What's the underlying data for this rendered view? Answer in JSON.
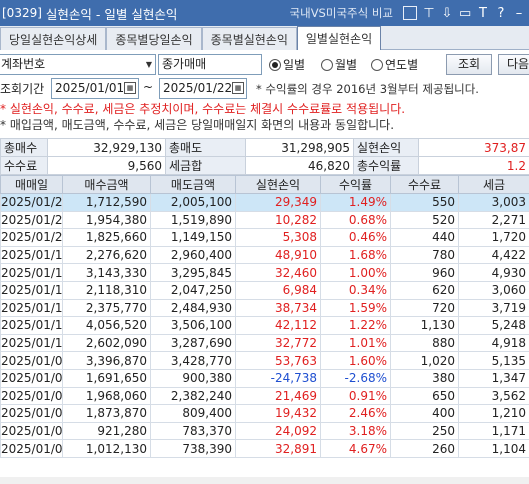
{
  "window": {
    "code": "[0329]",
    "title": "실현손익 - 일별 실현손익",
    "link": "국내VS미국주식 비교",
    "icons": [
      "copy-icon",
      "pin-icon",
      "download-icon",
      "print-icon",
      "text-size-icon",
      "help-icon",
      "minimize-icon"
    ]
  },
  "tabs": [
    {
      "label": "당일실현손익상세",
      "active": false
    },
    {
      "label": "종목별당일손익",
      "active": false
    },
    {
      "label": "종목별실현손익",
      "active": false
    },
    {
      "label": "일별실현손익",
      "active": true
    }
  ],
  "controls": {
    "account_label": "계좌번호",
    "account_name": "종가매매",
    "period_label": "조회기간",
    "start_date": "2025/01/01",
    "end_date": "2025/01/22",
    "tilde": "~",
    "radios": [
      {
        "label": "일별",
        "checked": true
      },
      {
        "label": "월별",
        "checked": false
      },
      {
        "label": "연도별",
        "checked": false
      }
    ],
    "search_button": "조회",
    "next_button": "다음",
    "period_note": "* 수익률의 경우 2016년 3월부터 제공됩니다."
  },
  "notices": {
    "warning": "* 실현손익, 수수료, 세금은 추정치이며, 수수료는 체결시 수수료률로 적용됩니다.",
    "info": "* 매입금액, 매도금액, 수수료, 세금은 당일매매일지 화면의 내용과 동일합니다."
  },
  "summary": {
    "total_buy_label": "총매수",
    "total_buy": "32,929,130",
    "total_sell_label": "총매도",
    "total_sell": "31,298,905",
    "realized_label": "실현손익",
    "realized": "373,87",
    "fee_label": "수수료",
    "fee": "9,560",
    "tax_label": "세금합",
    "tax": "46,820",
    "return_label": "총수익률",
    "return": "1.2"
  },
  "grid": {
    "columns": [
      "매매일",
      "매수금액",
      "매도금액",
      "실현손익",
      "수익률",
      "수수료",
      "세금"
    ],
    "rows": [
      [
        "2025/01/22",
        "1,712,590",
        "2,005,100",
        "29,349",
        "1.49%",
        "550",
        "3,003"
      ],
      [
        "2025/01/21",
        "1,954,380",
        "1,519,890",
        "10,282",
        "0.68%",
        "520",
        "2,271"
      ],
      [
        "2025/01/20",
        "1,825,660",
        "1,149,150",
        "5,308",
        "0.46%",
        "440",
        "1,720"
      ],
      [
        "2025/01/17",
        "2,276,620",
        "2,960,400",
        "48,910",
        "1.68%",
        "780",
        "4,422"
      ],
      [
        "2025/01/16",
        "3,143,330",
        "3,295,845",
        "32,460",
        "1.00%",
        "960",
        "4,930"
      ],
      [
        "2025/01/15",
        "2,118,310",
        "2,047,250",
        "6,984",
        "0.34%",
        "620",
        "3,060"
      ],
      [
        "2025/01/14",
        "2,375,770",
        "2,484,930",
        "38,734",
        "1.59%",
        "720",
        "3,719"
      ],
      [
        "2025/01/13",
        "4,056,520",
        "3,506,100",
        "42,112",
        "1.22%",
        "1,130",
        "5,248"
      ],
      [
        "2025/01/10",
        "2,602,090",
        "3,287,690",
        "32,772",
        "1.01%",
        "880",
        "4,918"
      ],
      [
        "2025/01/09",
        "3,396,870",
        "3,428,770",
        "53,763",
        "1.60%",
        "1,020",
        "5,135"
      ],
      [
        "2025/01/08",
        "1,691,650",
        "900,380",
        "-24,738",
        "-2.68%",
        "380",
        "1,347"
      ],
      [
        "2025/01/07",
        "1,968,060",
        "2,382,240",
        "21,469",
        "0.91%",
        "650",
        "3,562"
      ],
      [
        "2025/01/06",
        "1,873,870",
        "809,400",
        "19,432",
        "2.46%",
        "400",
        "1,210"
      ],
      [
        "2025/01/03",
        "921,280",
        "783,370",
        "24,092",
        "3.18%",
        "250",
        "1,171"
      ],
      [
        "2025/01/02",
        "1,012,130",
        "738,390",
        "32,891",
        "4.67%",
        "260",
        "1,104"
      ]
    ],
    "selected_row": 0
  },
  "colors": {
    "titlebar": "#3f6dad",
    "positive": "#e02020",
    "negative": "#1f4fd0",
    "selected": "#cde6f7"
  }
}
